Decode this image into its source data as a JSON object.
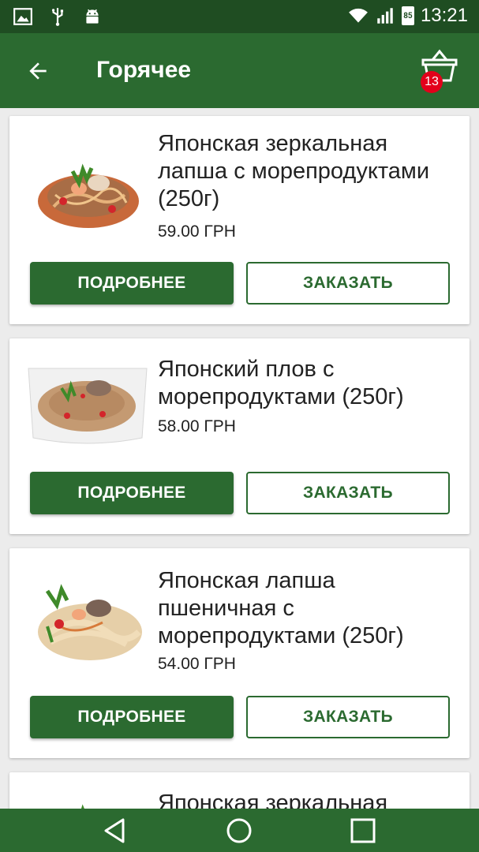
{
  "status_bar": {
    "time": "13:21",
    "battery_level": "85",
    "icons": [
      "image-icon",
      "usb-icon",
      "android-icon",
      "wifi-icon",
      "signal-icon",
      "battery-icon"
    ]
  },
  "app_bar": {
    "title": "Горячее",
    "cart_count": "13"
  },
  "products": [
    {
      "name": "Японская зеркальная лапша с морепродуктами (250г)",
      "price": "59.00 ГРН",
      "details_label": "ПОДРОБНЕЕ",
      "order_label": "ЗАКАЗАТЬ"
    },
    {
      "name": "Японский плов с морепродуктами (250г)",
      "price": "58.00 ГРН",
      "details_label": "ПОДРОБНЕЕ",
      "order_label": "ЗАКАЗАТЬ"
    },
    {
      "name": "Японская лапша пшеничная с морепродуктами (250г)",
      "price": "54.00 ГРН",
      "details_label": "ПОДРОБНЕЕ",
      "order_label": "ЗАКАЗАТЬ"
    },
    {
      "name": "Японская зеркальная"
    }
  ],
  "colors": {
    "primary": "#2b6a30",
    "status_bar": "#1f4d22",
    "badge": "#e3001b",
    "background": "#ececec"
  }
}
